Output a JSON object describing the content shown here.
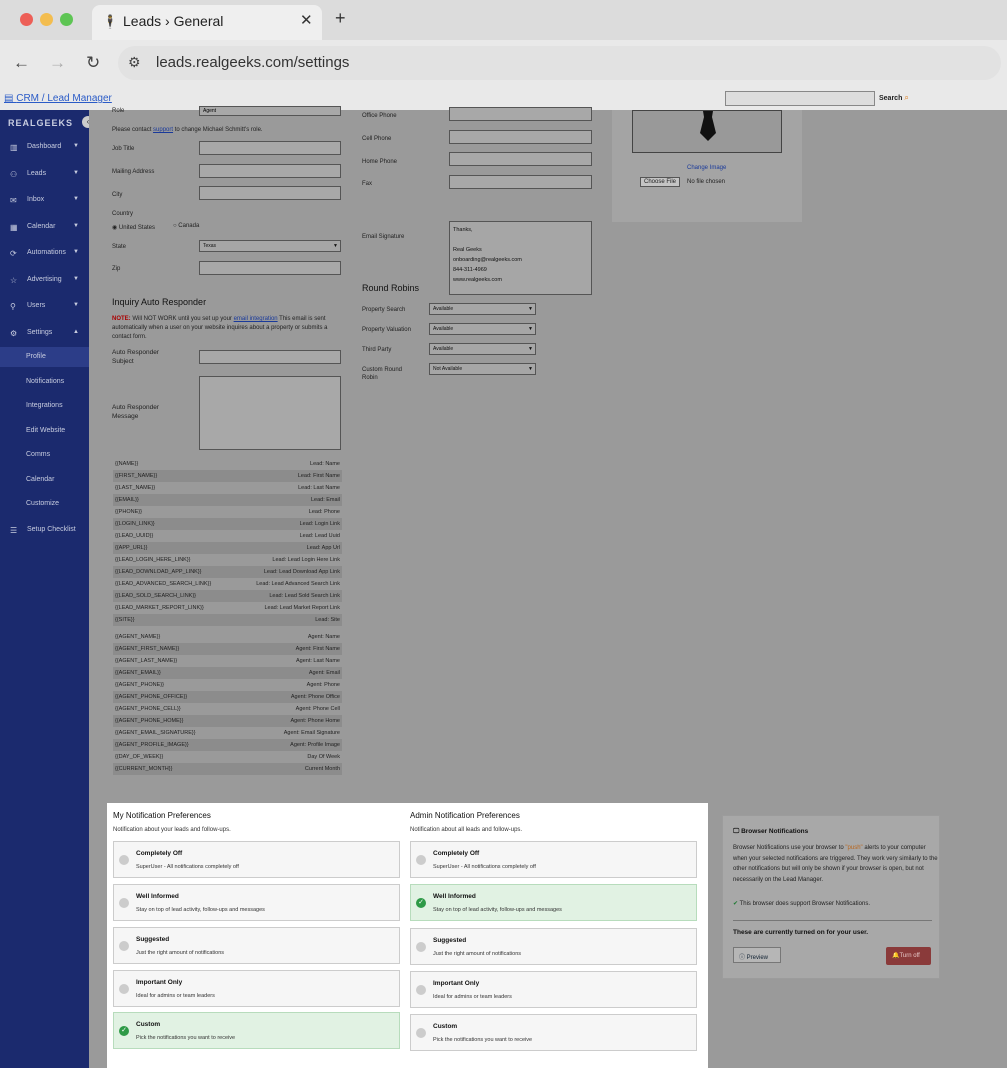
{
  "browser": {
    "tab_title": "Leads › General",
    "url": "leads.realgeeks.com/settings"
  },
  "topbar": {
    "crm_link": "CRM / Lead Manager",
    "search_label": "Search",
    "search_placeholder": ""
  },
  "sidebar": {
    "logo": "REALGEEKS",
    "items": [
      {
        "label": "Dashboard",
        "icon": "chart-icon"
      },
      {
        "label": "Leads",
        "icon": "users-icon"
      },
      {
        "label": "Inbox",
        "icon": "inbox-icon"
      },
      {
        "label": "Calendar",
        "icon": "calendar-icon"
      },
      {
        "label": "Automations",
        "icon": "automation-icon"
      },
      {
        "label": "Advertising",
        "icon": "star-icon"
      },
      {
        "label": "Users",
        "icon": "user-icon"
      },
      {
        "label": "Settings",
        "icon": "gear-icon"
      }
    ],
    "sub_items": [
      "Profile",
      "Notifications",
      "Integrations",
      "Edit Website",
      "Comms",
      "Calendar",
      "Customize"
    ],
    "setup": "Setup Checklist"
  },
  "profile": {
    "role_label": "Role",
    "role_value": "Agent",
    "role_note_prefix": "Please contact ",
    "role_note_link": "support",
    "role_note_suffix": " to change Michael Schmitt's role.",
    "job_title": "Job Title",
    "mailing_address": "Mailing Address",
    "city": "City",
    "country": "Country",
    "us": "United States",
    "canada": "Canada",
    "state": "State",
    "state_value": "Texas",
    "zip": "Zip",
    "office_phone": "Office Phone",
    "cell_phone": "Cell Phone",
    "home_phone": "Home Phone",
    "fax": "Fax",
    "email_signature": "Email Signature",
    "signature_lines": [
      "Thanks,",
      "",
      "Real Geeks",
      "onboarding@realgeeks.com",
      "844-311-4969",
      "www.realgeeks.com"
    ],
    "change_image": "Change Image",
    "choose_file": "Choose File",
    "no_file": "No file chosen"
  },
  "auto_responder": {
    "title": "Inquiry Auto Responder",
    "note_bold": "NOTE:",
    "note_pre": " Will NOT WORK until you set up your ",
    "note_link": "email integration",
    "note_post": " This email is sent automatically when a user on your website inquires about a property or submits a contact form.",
    "subject": "Auto Responder Subject",
    "message": "Auto Responder Message"
  },
  "round_robins": {
    "title": "Round Robins",
    "rows": [
      {
        "label": "Property Search",
        "value": "Available"
      },
      {
        "label": "Property Valuation",
        "value": "Available"
      },
      {
        "label": "Third Party",
        "value": "Available"
      },
      {
        "label": "Custom Round Robin",
        "value": "Not Available"
      }
    ]
  },
  "merge_fields": [
    [
      "{{NAME}}",
      "Lead: Name"
    ],
    [
      "{{FIRST_NAME}}",
      "Lead: First Name"
    ],
    [
      "{{LAST_NAME}}",
      "Lead: Last Name"
    ],
    [
      "{{EMAIL}}",
      "Lead: Email"
    ],
    [
      "{{PHONE}}",
      "Lead: Phone"
    ],
    [
      "{{LOGIN_LINK}}",
      "Lead: Login Link"
    ],
    [
      "{{LEAD_UUID}}",
      "Lead: Lead Uuid"
    ],
    [
      "{{APP_URL}}",
      "Lead: App Url"
    ],
    [
      "{{LEAD_LOGIN_HERE_LINK}}",
      "Lead: Lead Login Here Link"
    ],
    [
      "{{LEAD_DOWNLOAD_APP_LINK}}",
      "Lead: Lead Download App Link"
    ],
    [
      "{{LEAD_ADVANCED_SEARCH_LINK}}",
      "Lead: Lead Advanced Search Link"
    ],
    [
      "{{LEAD_SOLD_SEARCH_LINK}}",
      "Lead: Lead Sold Search Link"
    ],
    [
      "{{LEAD_MARKET_REPORT_LINK}}",
      "Lead: Lead Market Report Link"
    ],
    [
      "{{SITE}}",
      "Lead: Site"
    ]
  ],
  "agent_fields": [
    [
      "{{AGENT_NAME}}",
      "Agent: Name"
    ],
    [
      "{{AGENT_FIRST_NAME}}",
      "Agent: First Name"
    ],
    [
      "{{AGENT_LAST_NAME}}",
      "Agent: Last Name"
    ],
    [
      "{{AGENT_EMAIL}}",
      "Agent: Email"
    ],
    [
      "{{AGENT_PHONE}}",
      "Agent: Phone"
    ],
    [
      "{{AGENT_PHONE_OFFICE}}",
      "Agent: Phone Office"
    ],
    [
      "{{AGENT_PHONE_CELL}}",
      "Agent: Phone Cell"
    ],
    [
      "{{AGENT_PHONE_HOME}}",
      "Agent: Phone Home"
    ],
    [
      "{{AGENT_EMAIL_SIGNATURE}}",
      "Agent: Email Signature"
    ],
    [
      "{{AGENT_PROFILE_IMAGE}}",
      "Agent: Profile Image"
    ],
    [
      "{{DAY_OF_WEEK}}",
      "Day Of Week"
    ],
    [
      "{{CURRENT_MONTH}}",
      "Current Month"
    ]
  ],
  "my_prefs": {
    "title": "My Notification Preferences",
    "subtitle": "Notification about your leads and follow-ups.",
    "options": [
      {
        "title": "Completely Off",
        "desc": "SuperUser - All notifications completely off",
        "selected": false
      },
      {
        "title": "Well Informed",
        "desc": "Stay on top of lead activity, follow-ups and messages",
        "selected": false
      },
      {
        "title": "Suggested",
        "desc": "Just the right amount of notifications",
        "selected": false
      },
      {
        "title": "Important Only",
        "desc": "Ideal for admins or team leaders",
        "selected": false
      },
      {
        "title": "Custom",
        "desc": "Pick the notifications you want to receive",
        "selected": true
      }
    ]
  },
  "admin_prefs": {
    "title": "Admin Notification Preferences",
    "subtitle": "Notification about all leads and follow-ups.",
    "options": [
      {
        "title": "Completely Off",
        "desc": "SuperUser - All notifications completely off",
        "selected": false
      },
      {
        "title": "Well Informed",
        "desc": "Stay on top of lead activity, follow-ups and messages",
        "selected": true
      },
      {
        "title": "Suggested",
        "desc": "Just the right amount of notifications",
        "selected": false
      },
      {
        "title": "Important Only",
        "desc": "Ideal for admins or team leaders",
        "selected": false
      },
      {
        "title": "Custom",
        "desc": "Pick the notifications you want to receive",
        "selected": false
      }
    ]
  },
  "browser_notifications": {
    "title": "Browser Notifications",
    "desc_pre": "Browser Notifications use your browser to ",
    "desc_push": "\"push\"",
    "desc_post": " alerts to your computer when your selected notifications are triggered. They work very similarly to the other notifications but will only be shown if your browser is open, but not necessarily on the Lead Manager.",
    "support": "This browser does support Browser Notifications.",
    "turned_on": "These are currently turned on for your user.",
    "preview": "Preview",
    "turn_off": "Turn off"
  }
}
